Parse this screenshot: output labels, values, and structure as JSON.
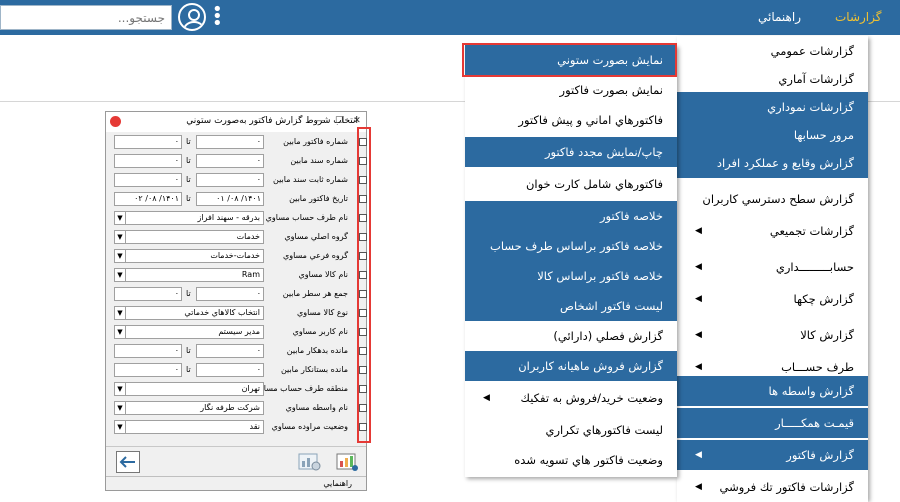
{
  "topbar": {
    "search_placeholder": "جستجو...",
    "menu_reports": "گزارشات",
    "menu_help": "راهنمائي"
  },
  "main_menu": [
    {
      "label": "گزارشات عمومي",
      "style": "white",
      "arrow": false
    },
    {
      "label": "گزارشات آماري",
      "style": "white",
      "arrow": false
    },
    {
      "label": "گزارشات نموداري",
      "style": "blue",
      "arrow": false
    },
    {
      "label": "مرور حسابها",
      "style": "blue",
      "arrow": false
    },
    {
      "label": "گزارش وقايع و عملكرد افراد",
      "style": "blue",
      "arrow": false
    },
    {
      "label": "گزارش سطح دسترسي كاربران",
      "style": "white",
      "arrow": false
    },
    {
      "label": "گزارشات تجميعي",
      "style": "white",
      "arrow": true
    },
    {
      "label": "حسابـــــــــداري",
      "style": "white",
      "arrow": true
    },
    {
      "label": "گزارش چكها",
      "style": "white",
      "arrow": true
    },
    {
      "label": "گزارش كالا",
      "style": "white",
      "arrow": true
    },
    {
      "label": "طرف حســـاب",
      "style": "white",
      "arrow": true
    },
    {
      "label": "گزارش واسطه ها",
      "style": "blue",
      "arrow": false
    },
    {
      "label": "قيمـت همكـــــار",
      "style": "blue",
      "arrow": false
    },
    {
      "label": "گزارش فاكتور",
      "style": "blue",
      "arrow": true
    },
    {
      "label": "گزارشات فاكتور تك فروشي",
      "style": "white",
      "arrow": true
    }
  ],
  "sub_menu": [
    {
      "label": "نمايش بصورت ستوني",
      "style": "blue",
      "arrow": false
    },
    {
      "label": "نمايش بصورت فاكتور",
      "style": "white",
      "arrow": false
    },
    {
      "label": "فاكتورهاي اماني و پيش فاكتور",
      "style": "white",
      "arrow": false
    },
    {
      "label": "چاپ/نمايش مجدد فاكتور",
      "style": "blue",
      "arrow": false
    },
    {
      "label": "فاكتورهاي شامل كارت خوان",
      "style": "white",
      "arrow": false
    },
    {
      "label": "خلاصه فاكتور",
      "style": "blue",
      "arrow": false
    },
    {
      "label": "خلاصه فاكتور براساس طرف حساب",
      "style": "blue",
      "arrow": false
    },
    {
      "label": "خلاصه فاكتور براساس كالا",
      "style": "blue",
      "arrow": false
    },
    {
      "label": "ليست فاكتور اشخاص",
      "style": "blue",
      "arrow": false
    },
    {
      "label": "گزارش فصلي (دارائي)",
      "style": "white",
      "arrow": false
    },
    {
      "label": "گزارش فروش ماهيانه كاربران",
      "style": "blue",
      "arrow": false
    },
    {
      "label": "وضعيت خريد/فروش به تفكيك",
      "style": "white",
      "arrow": true
    },
    {
      "label": "ليست فاكتورهاي تكراري",
      "style": "white",
      "arrow": false
    },
    {
      "label": "وضعيت فاكتور هاي تسويه شده",
      "style": "white",
      "arrow": false
    }
  ],
  "dialog": {
    "title": "انتخاب شروط گزارش فاكتور به‌صورت ستوني",
    "to_label": "تا",
    "status_text": "راهنمايي",
    "rows": [
      {
        "label": "شماره فاكتور مابين",
        "type": "range",
        "from": "۰",
        "to": "۰"
      },
      {
        "label": "شماره سند مابين",
        "type": "range",
        "from": "۰",
        "to": "۰"
      },
      {
        "label": "شماره ثابت سند مابين",
        "type": "range",
        "from": "۰",
        "to": "۰"
      },
      {
        "label": "تاريخ فاكتور مابين",
        "type": "range",
        "from": "۱۴۰۱/ ۰۸/ ۰۱",
        "to": "۱۴۰۱/ ۰۸/ ۰۲"
      },
      {
        "label": "نام طرف حساب مساوي",
        "type": "combo",
        "value": "بدرقه - سهند افراز"
      },
      {
        "label": "گروه اصلي مساوي",
        "type": "combo",
        "value": "خدمات"
      },
      {
        "label": "گروه فرعي مساوي",
        "type": "combo",
        "value": "خدمات-خدمات"
      },
      {
        "label": "نام كالا مساوي",
        "type": "combo",
        "value": "Ram"
      },
      {
        "label": "جمع هر سطر مابين",
        "type": "range",
        "from": "۰",
        "to": "۰"
      },
      {
        "label": "نوع كالا مساوي",
        "type": "combo",
        "value": "انتخاب كالاهاي خدماتي"
      },
      {
        "label": "نام كاربر مساوي",
        "type": "combo",
        "value": "مدير سيستم"
      },
      {
        "label": "مانده بدهكار مابين",
        "type": "range",
        "from": "۰",
        "to": "۰"
      },
      {
        "label": "مانده بستانكار مابين",
        "type": "range",
        "from": "۰",
        "to": "۰"
      },
      {
        "label": "منطقه طرف حساب مساوي",
        "type": "combo",
        "value": "تهران"
      },
      {
        "label": "نام واسطه مساوي",
        "type": "combo",
        "value": "شركت طرفه نگار"
      },
      {
        "label": "وضعيت مراوده مساوي",
        "type": "combo",
        "value": "نقد"
      }
    ]
  }
}
